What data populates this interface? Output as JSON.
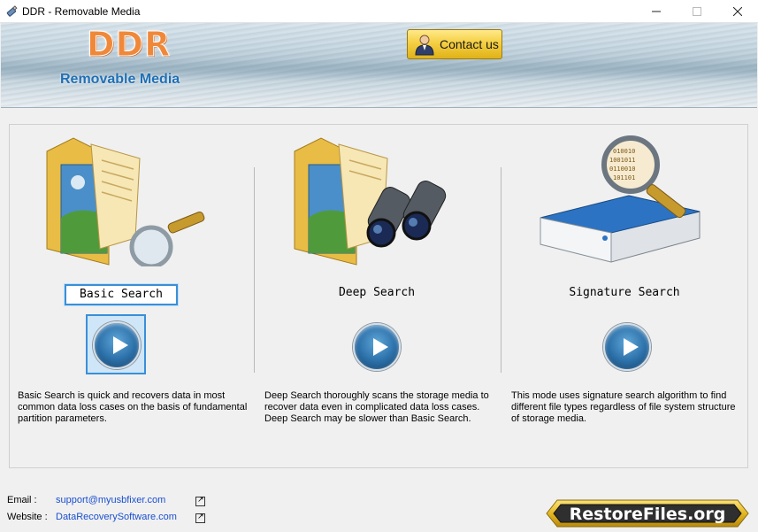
{
  "window": {
    "title": "DDR - Removable Media"
  },
  "header": {
    "logo": "DDR",
    "subtitle": "Removable Media",
    "contact_label": "Contact us"
  },
  "modes": [
    {
      "title": "Basic Search",
      "description": "Basic Search is quick and recovers data in most common data loss cases on the basis of fundamental partition parameters."
    },
    {
      "title": "Deep Search",
      "description": "Deep Search thoroughly scans the storage media to recover data even in complicated data loss cases. Deep Search may be slower than Basic Search."
    },
    {
      "title": "Signature Search",
      "description": "This mode uses signature search algorithm to find different file types regardless of file system structure of storage media."
    }
  ],
  "footer": {
    "email_label": "Email :",
    "email_value": "support@myusbfixer.com",
    "website_label": "Website :",
    "website_value": "DataRecoverySoftware.com",
    "badge_text": "RestoreFiles.org"
  },
  "colors": {
    "accent": "#3a8fd8",
    "logo_orange": "#f0883a",
    "subtitle_blue": "#1f6fb5",
    "link_blue": "#1a4fd0",
    "badge_gold": "#e2b822"
  },
  "icons": {
    "app": "usb-drive-icon",
    "contact": "person-icon",
    "basic": "folder-magnifier-icon",
    "deep": "folder-binoculars-icon",
    "signature": "drive-magnifier-icon",
    "play": "play-icon",
    "external": "external-link-icon"
  }
}
